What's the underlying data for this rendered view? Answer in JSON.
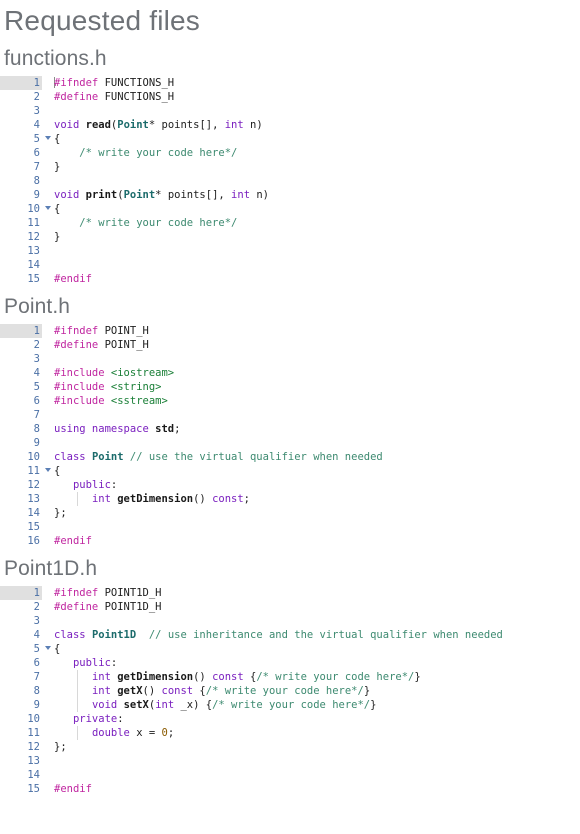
{
  "page": {
    "title": "Requested files"
  },
  "files": [
    {
      "name": "functions.h",
      "highlight_line": 1,
      "lines": [
        {
          "n": "1",
          "fold": false,
          "guide": false,
          "tokens": [
            {
              "t": "pre",
              "s": "#ifndef"
            },
            {
              "t": "pl",
              "s": " FUNCTIONS_H"
            }
          ]
        },
        {
          "n": "2",
          "fold": false,
          "guide": false,
          "tokens": [
            {
              "t": "pre",
              "s": "#define"
            },
            {
              "t": "pl",
              "s": " FUNCTIONS_H"
            }
          ]
        },
        {
          "n": "3",
          "fold": false,
          "guide": false,
          "tokens": []
        },
        {
          "n": "4",
          "fold": false,
          "guide": false,
          "tokens": [
            {
              "t": "kw",
              "s": "void"
            },
            {
              "t": "pl",
              "s": " "
            },
            {
              "t": "fn",
              "s": "read"
            },
            {
              "t": "pl",
              "s": "("
            },
            {
              "t": "cls",
              "s": "Point"
            },
            {
              "t": "op",
              "s": "*"
            },
            {
              "t": "pl",
              "s": " points[], "
            },
            {
              "t": "kw",
              "s": "int"
            },
            {
              "t": "pl",
              "s": " n)"
            }
          ]
        },
        {
          "n": "5",
          "fold": true,
          "guide": false,
          "tokens": [
            {
              "t": "pl",
              "s": "{"
            }
          ]
        },
        {
          "n": "6",
          "fold": false,
          "guide": false,
          "tokens": [
            {
              "t": "pl",
              "s": "    "
            },
            {
              "t": "cmt",
              "s": "/* write your code here*/"
            }
          ]
        },
        {
          "n": "7",
          "fold": false,
          "guide": false,
          "tokens": [
            {
              "t": "pl",
              "s": "}"
            }
          ]
        },
        {
          "n": "8",
          "fold": false,
          "guide": false,
          "tokens": []
        },
        {
          "n": "9",
          "fold": false,
          "guide": false,
          "tokens": [
            {
              "t": "kw",
              "s": "void"
            },
            {
              "t": "pl",
              "s": " "
            },
            {
              "t": "fn",
              "s": "print"
            },
            {
              "t": "pl",
              "s": "("
            },
            {
              "t": "cls",
              "s": "Point"
            },
            {
              "t": "op",
              "s": "*"
            },
            {
              "t": "pl",
              "s": " points[], "
            },
            {
              "t": "kw",
              "s": "int"
            },
            {
              "t": "pl",
              "s": " n)"
            }
          ]
        },
        {
          "n": "10",
          "fold": true,
          "guide": false,
          "tokens": [
            {
              "t": "pl",
              "s": "{"
            }
          ]
        },
        {
          "n": "11",
          "fold": false,
          "guide": false,
          "tokens": [
            {
              "t": "pl",
              "s": "    "
            },
            {
              "t": "cmt",
              "s": "/* write your code here*/"
            }
          ]
        },
        {
          "n": "12",
          "fold": false,
          "guide": false,
          "tokens": [
            {
              "t": "pl",
              "s": "}"
            }
          ]
        },
        {
          "n": "13",
          "fold": false,
          "guide": false,
          "tokens": []
        },
        {
          "n": "14",
          "fold": false,
          "guide": false,
          "tokens": []
        },
        {
          "n": "15",
          "fold": false,
          "guide": false,
          "tokens": [
            {
              "t": "pre",
              "s": "#endif"
            }
          ]
        }
      ]
    },
    {
      "name": "Point.h",
      "highlight_line": 1,
      "lines": [
        {
          "n": "1",
          "fold": false,
          "guide": false,
          "tokens": [
            {
              "t": "pre",
              "s": "#ifndef"
            },
            {
              "t": "pl",
              "s": " POINT_H"
            }
          ]
        },
        {
          "n": "2",
          "fold": false,
          "guide": false,
          "tokens": [
            {
              "t": "pre",
              "s": "#define"
            },
            {
              "t": "pl",
              "s": " POINT_H"
            }
          ]
        },
        {
          "n": "3",
          "fold": false,
          "guide": false,
          "tokens": []
        },
        {
          "n": "4",
          "fold": false,
          "guide": false,
          "tokens": [
            {
              "t": "pre",
              "s": "#include"
            },
            {
              "t": "pl",
              "s": " "
            },
            {
              "t": "str",
              "s": "<iostream>"
            }
          ]
        },
        {
          "n": "5",
          "fold": false,
          "guide": false,
          "tokens": [
            {
              "t": "pre",
              "s": "#include"
            },
            {
              "t": "pl",
              "s": " "
            },
            {
              "t": "str",
              "s": "<string>"
            }
          ]
        },
        {
          "n": "6",
          "fold": false,
          "guide": false,
          "tokens": [
            {
              "t": "pre",
              "s": "#include"
            },
            {
              "t": "pl",
              "s": " "
            },
            {
              "t": "str",
              "s": "<sstream>"
            }
          ]
        },
        {
          "n": "7",
          "fold": false,
          "guide": false,
          "tokens": []
        },
        {
          "n": "8",
          "fold": false,
          "guide": false,
          "tokens": [
            {
              "t": "kw",
              "s": "using namespace"
            },
            {
              "t": "pl",
              "s": " "
            },
            {
              "t": "fn",
              "s": "std"
            },
            {
              "t": "pl",
              "s": ";"
            }
          ]
        },
        {
          "n": "9",
          "fold": false,
          "guide": false,
          "tokens": []
        },
        {
          "n": "10",
          "fold": false,
          "guide": false,
          "tokens": [
            {
              "t": "kw",
              "s": "class"
            },
            {
              "t": "pl",
              "s": " "
            },
            {
              "t": "cls",
              "s": "Point"
            },
            {
              "t": "pl",
              "s": " "
            },
            {
              "t": "cmt",
              "s": "// use the virtual qualifier when needed"
            }
          ]
        },
        {
          "n": "11",
          "fold": true,
          "guide": false,
          "tokens": [
            {
              "t": "pl",
              "s": "{"
            }
          ]
        },
        {
          "n": "12",
          "fold": false,
          "guide": false,
          "tokens": [
            {
              "t": "pl",
              "s": "   "
            },
            {
              "t": "kw",
              "s": "public"
            },
            {
              "t": "pl",
              "s": ":"
            }
          ]
        },
        {
          "n": "13",
          "fold": false,
          "guide": true,
          "tokens": [
            {
              "t": "pl",
              "s": "      "
            },
            {
              "t": "kw",
              "s": "int"
            },
            {
              "t": "pl",
              "s": " "
            },
            {
              "t": "fn",
              "s": "getDimension"
            },
            {
              "t": "pl",
              "s": "() "
            },
            {
              "t": "kw",
              "s": "const"
            },
            {
              "t": "pl",
              "s": ";"
            }
          ]
        },
        {
          "n": "14",
          "fold": false,
          "guide": false,
          "tokens": [
            {
              "t": "pl",
              "s": "};"
            }
          ]
        },
        {
          "n": "15",
          "fold": false,
          "guide": false,
          "tokens": []
        },
        {
          "n": "16",
          "fold": false,
          "guide": false,
          "tokens": [
            {
              "t": "pre",
              "s": "#endif"
            }
          ]
        }
      ]
    },
    {
      "name": "Point1D.h",
      "highlight_line": 1,
      "lines": [
        {
          "n": "1",
          "fold": false,
          "guide": false,
          "tokens": [
            {
              "t": "pre",
              "s": "#ifndef"
            },
            {
              "t": "pl",
              "s": " POINT1D_H"
            }
          ]
        },
        {
          "n": "2",
          "fold": false,
          "guide": false,
          "tokens": [
            {
              "t": "pre",
              "s": "#define"
            },
            {
              "t": "pl",
              "s": " POINT1D_H"
            }
          ]
        },
        {
          "n": "3",
          "fold": false,
          "guide": false,
          "tokens": []
        },
        {
          "n": "4",
          "fold": false,
          "guide": false,
          "tokens": [
            {
              "t": "kw",
              "s": "class"
            },
            {
              "t": "pl",
              "s": " "
            },
            {
              "t": "cls",
              "s": "Point1D"
            },
            {
              "t": "pl",
              "s": "  "
            },
            {
              "t": "cmt",
              "s": "// use inheritance and the virtual qualifier when needed"
            }
          ]
        },
        {
          "n": "5",
          "fold": true,
          "guide": false,
          "tokens": [
            {
              "t": "pl",
              "s": "{"
            }
          ]
        },
        {
          "n": "6",
          "fold": false,
          "guide": false,
          "tokens": [
            {
              "t": "pl",
              "s": "   "
            },
            {
              "t": "kw",
              "s": "public"
            },
            {
              "t": "pl",
              "s": ":"
            }
          ]
        },
        {
          "n": "7",
          "fold": false,
          "guide": true,
          "tokens": [
            {
              "t": "pl",
              "s": "      "
            },
            {
              "t": "kw",
              "s": "int"
            },
            {
              "t": "pl",
              "s": " "
            },
            {
              "t": "fn",
              "s": "getDimension"
            },
            {
              "t": "pl",
              "s": "() "
            },
            {
              "t": "kw",
              "s": "const"
            },
            {
              "t": "pl",
              "s": " {"
            },
            {
              "t": "cmt",
              "s": "/* write your code here*/"
            },
            {
              "t": "pl",
              "s": "}"
            }
          ]
        },
        {
          "n": "8",
          "fold": false,
          "guide": true,
          "tokens": [
            {
              "t": "pl",
              "s": "      "
            },
            {
              "t": "kw",
              "s": "int"
            },
            {
              "t": "pl",
              "s": " "
            },
            {
              "t": "fn",
              "s": "getX"
            },
            {
              "t": "pl",
              "s": "() "
            },
            {
              "t": "kw",
              "s": "const"
            },
            {
              "t": "pl",
              "s": " {"
            },
            {
              "t": "cmt",
              "s": "/* write your code here*/"
            },
            {
              "t": "pl",
              "s": "}"
            }
          ]
        },
        {
          "n": "9",
          "fold": false,
          "guide": true,
          "tokens": [
            {
              "t": "pl",
              "s": "      "
            },
            {
              "t": "kw",
              "s": "void"
            },
            {
              "t": "pl",
              "s": " "
            },
            {
              "t": "fn",
              "s": "setX"
            },
            {
              "t": "pl",
              "s": "("
            },
            {
              "t": "kw",
              "s": "int"
            },
            {
              "t": "pl",
              "s": " _x) {"
            },
            {
              "t": "cmt",
              "s": "/* write your code here*/"
            },
            {
              "t": "pl",
              "s": "}"
            }
          ]
        },
        {
          "n": "10",
          "fold": false,
          "guide": false,
          "tokens": [
            {
              "t": "pl",
              "s": "   "
            },
            {
              "t": "kw",
              "s": "private"
            },
            {
              "t": "pl",
              "s": ":"
            }
          ]
        },
        {
          "n": "11",
          "fold": false,
          "guide": true,
          "tokens": [
            {
              "t": "pl",
              "s": "      "
            },
            {
              "t": "kw",
              "s": "double"
            },
            {
              "t": "pl",
              "s": " x = "
            },
            {
              "t": "num",
              "s": "0"
            },
            {
              "t": "pl",
              "s": ";"
            }
          ]
        },
        {
          "n": "12",
          "fold": false,
          "guide": false,
          "tokens": [
            {
              "t": "pl",
              "s": "};"
            }
          ]
        },
        {
          "n": "13",
          "fold": false,
          "guide": false,
          "tokens": []
        },
        {
          "n": "14",
          "fold": false,
          "guide": false,
          "tokens": []
        },
        {
          "n": "15",
          "fold": false,
          "guide": false,
          "tokens": [
            {
              "t": "pre",
              "s": "#endif"
            }
          ]
        }
      ]
    }
  ],
  "colors": {
    "heading": "#6e7277",
    "preprocessor": "#c026a0",
    "keyword": "#7a1fbf",
    "class": "#1b6b6b",
    "comment": "#3d8a70",
    "plain": "#202020",
    "linenumber": "#4a6fa5",
    "gutter_highlight": "#e0e0e0",
    "background": "#ffffff"
  }
}
